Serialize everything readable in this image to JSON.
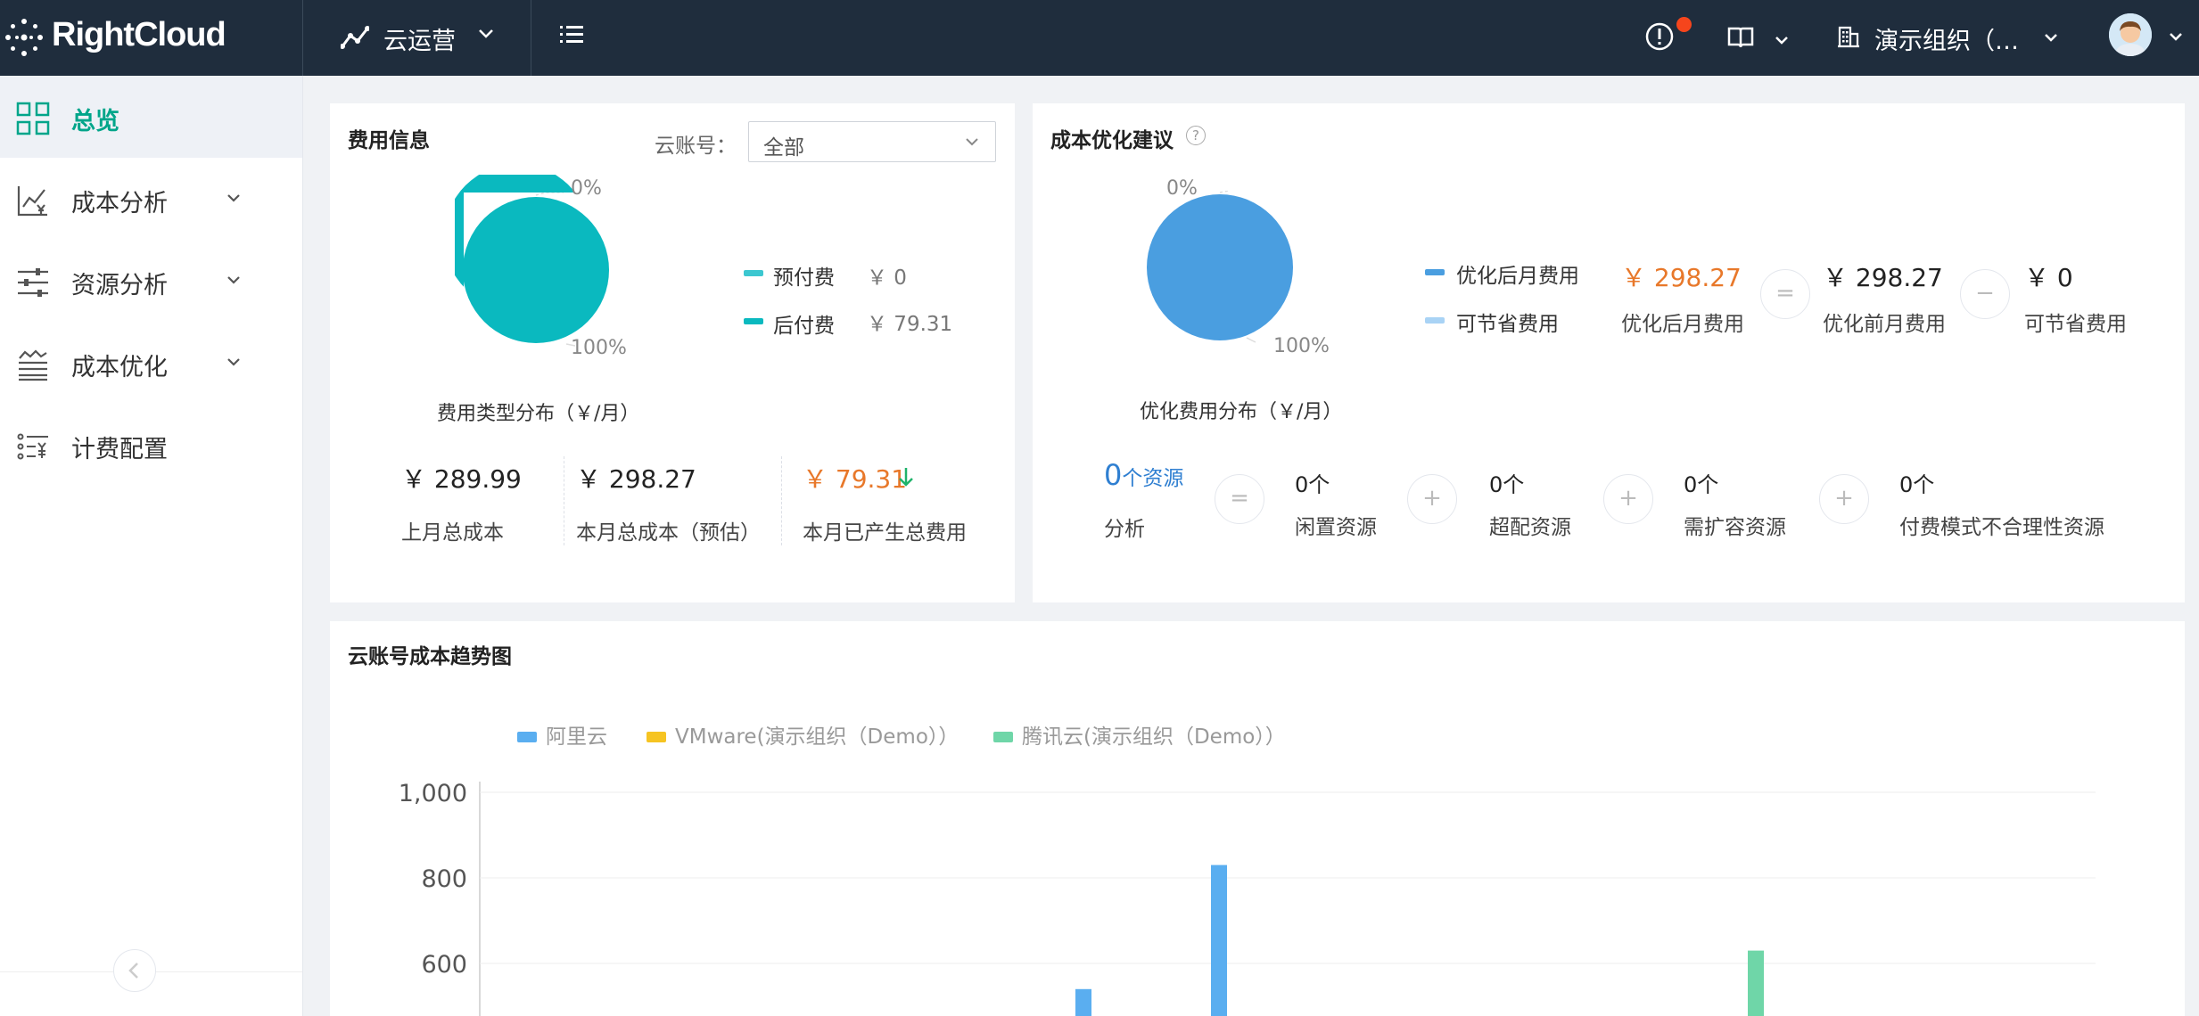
{
  "header": {
    "logo_text": "RightCloud",
    "module_name": "云运营",
    "org_name": "演示组织（D...",
    "colors": {
      "bg": "#1f2d3d",
      "alert_dot": "#f5451c"
    }
  },
  "sidebar": {
    "items": [
      {
        "label": "总览",
        "icon": "grid-icon",
        "active": true
      },
      {
        "label": "成本分析",
        "icon": "cost-chart-icon"
      },
      {
        "label": "资源分析",
        "icon": "sliders-icon"
      },
      {
        "label": "成本优化",
        "icon": "optimize-icon"
      },
      {
        "label": "计费配置",
        "icon": "billing-list-icon"
      }
    ]
  },
  "cost_info": {
    "title": "费用信息",
    "account_label": "云账号：",
    "account_value": "全部",
    "pie_label_top": "0%",
    "pie_label_bottom": "100%",
    "pie_caption": "费用类型分布（￥/月）",
    "legend": [
      {
        "name": "预付费",
        "value": "￥ 0",
        "color": "#3cc7d0"
      },
      {
        "name": "后付费",
        "value": "￥ 79.31",
        "color": "#0ab9bf"
      }
    ],
    "stats": [
      {
        "value": "￥ 289.99",
        "label": "上月总成本"
      },
      {
        "value": "￥ 298.27",
        "label": "本月总成本（预估）"
      },
      {
        "value": "￥ 79.31",
        "label": "本月已产生总费用",
        "trend": "down"
      }
    ]
  },
  "optimization": {
    "title": "成本优化建议",
    "pie_label_top": "0%",
    "pie_label_bottom": "100%",
    "pie_caption": "优化费用分布（￥/月）",
    "legend": [
      {
        "name": "优化后月费用",
        "color": "#4a9ee0"
      },
      {
        "name": "可节省费用",
        "color": "#a9d3f5"
      }
    ],
    "equation": [
      {
        "value": "￥ 298.27",
        "label": "优化后月费用"
      },
      {
        "op": "="
      },
      {
        "value": "￥ 298.27",
        "label": "优化前月费用"
      },
      {
        "op": "−"
      },
      {
        "value": "￥ 0",
        "label": "可节省费用"
      }
    ],
    "resources": {
      "count": "0",
      "unit": "个资源",
      "label": "分析",
      "items": [
        {
          "value": "0个",
          "label": "闲置资源"
        },
        {
          "value": "0个",
          "label": "超配资源"
        },
        {
          "value": "0个",
          "label": "需扩容资源"
        },
        {
          "value": "0个",
          "label": "付费模式不合理性资源"
        }
      ]
    }
  },
  "trend": {
    "title": "云账号成本趋势图"
  },
  "chart_data": {
    "type": "bar",
    "title": "",
    "series": [
      {
        "name": "阿里云",
        "color": "#5aaef0"
      },
      {
        "name": "VMware(演示组织（Demo））",
        "color": "#f6c422"
      },
      {
        "name": "腾讯云(演示组织（Demo））",
        "color": "#6fd6a8"
      }
    ],
    "yticks": [
      "1,000",
      "800",
      "600"
    ],
    "ylim": [
      600,
      1000
    ],
    "visible_bars": [
      {
        "series": "阿里云",
        "value": 540
      },
      {
        "series": "阿里云",
        "value": 830
      },
      {
        "series": "腾讯云(演示组织（Demo））",
        "value": 630
      }
    ],
    "legend_position": "top-left"
  }
}
